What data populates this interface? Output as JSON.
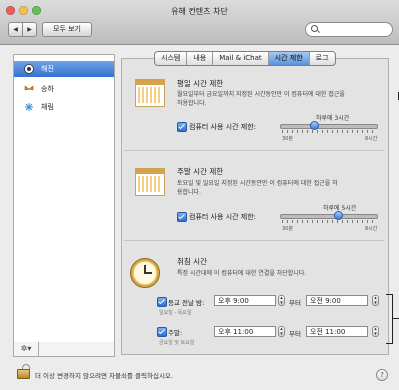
{
  "window": {
    "title": "유해 컨텐츠 차단"
  },
  "toolbar": {
    "back": "◀",
    "forward": "▶",
    "show_all": "모두 보기",
    "search_icon": "search-icon"
  },
  "sidebar": {
    "items": [
      {
        "label": "해진",
        "icon": "user-photo-icon",
        "selected": true
      },
      {
        "label": "승하",
        "icon": "butterfly-user-icon",
        "selected": false
      },
      {
        "label": "채림",
        "icon": "snowflake-user-icon",
        "selected": false
      }
    ],
    "action_icon": "✲▾"
  },
  "tabs": [
    "시스템",
    "내용",
    "Mail & iChat",
    "시간 제한",
    "로그"
  ],
  "active_tab": "시간 제한",
  "weekday": {
    "title": "평일 시간 제한",
    "desc": [
      "월요일부터 금요일까지 지정된 시간동안만 이 컴퓨터에 대한 접근을",
      "허용합니다."
    ],
    "checkbox_label": "컴퓨터 사용 시간 제한:",
    "checked": true,
    "slider_value_label": "하루에 3시간",
    "slider_fraction": 0.35,
    "min_label": "30분",
    "max_label": "8시간"
  },
  "weekend": {
    "title": "주말 시간 제한",
    "desc": [
      "토요일 및 일요일 지정된 시간동안만 이 컴퓨터에 대한 접근을 허",
      "용합니다."
    ],
    "checkbox_label": "컴퓨터 사용 시간 제한:",
    "checked": true,
    "slider_value_label": "하루에 5시간",
    "slider_fraction": 0.6,
    "min_label": "30분",
    "max_label": "8시간"
  },
  "bedtime": {
    "title": "취침 시간",
    "desc": "특정 시간대에 이 컴퓨터에 대한 연결을 차단합니다.",
    "school_nights": {
      "label": "등교 전날 밤:",
      "sub": "일요일 - 목요일",
      "checked": true,
      "from": "오후  9:00",
      "to_label": "부터",
      "to": "오전  9:00"
    },
    "weekend": {
      "label": "주말:",
      "sub": "금요일 및 토요일",
      "checked": true,
      "from": "오후 11:00",
      "to_label": "부터",
      "to": "오전 11:00"
    }
  },
  "footer": {
    "lock_text": "더 이상 변경하지 않으려면 자물쇠를 클릭하십시오.",
    "help": "?"
  },
  "colors": {
    "selection": "#3571cf",
    "accent": "#2f6fd3",
    "window_bg": "#ececec"
  }
}
